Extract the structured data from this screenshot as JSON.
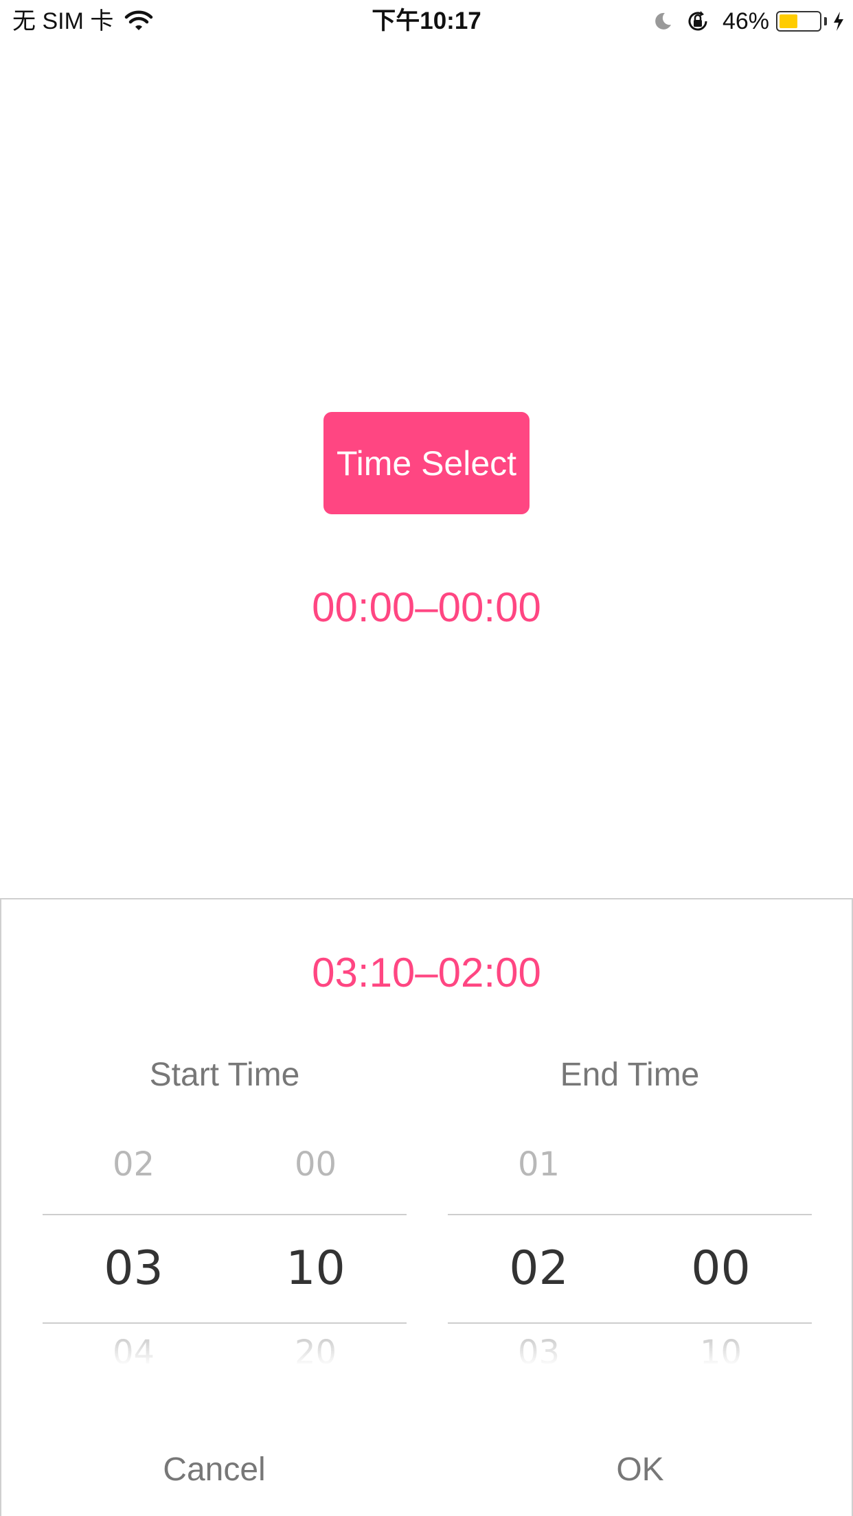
{
  "status_bar": {
    "carrier": "无 SIM 卡",
    "time": "下午10:17",
    "battery_percent": "46%",
    "battery_level": 0.46,
    "battery_color": "#ffcc00",
    "icons": [
      "wifi-icon",
      "moon-icon",
      "rotation-lock-icon",
      "battery-icon",
      "charging-bolt-icon"
    ]
  },
  "main": {
    "time_select_label": "Time Select",
    "selected_range": "00:00–00:00"
  },
  "sheet": {
    "range": "03:10–02:00",
    "start_label": "Start Time",
    "end_label": "End Time",
    "start": {
      "hours": {
        "prev": "02",
        "current": "03",
        "next": "04"
      },
      "minutes": {
        "prev": "00",
        "current": "10",
        "next": "20"
      }
    },
    "end": {
      "hours": {
        "prev": "01",
        "current": "02",
        "next": "03"
      },
      "minutes": {
        "prev": "",
        "current": "00",
        "next": "10"
      }
    },
    "cancel_label": "Cancel",
    "ok_label": "OK"
  },
  "colors": {
    "accent": "#ff4682",
    "picker_selected": "#333333",
    "picker_faded": "#b8b8b8",
    "label": "#777777"
  }
}
